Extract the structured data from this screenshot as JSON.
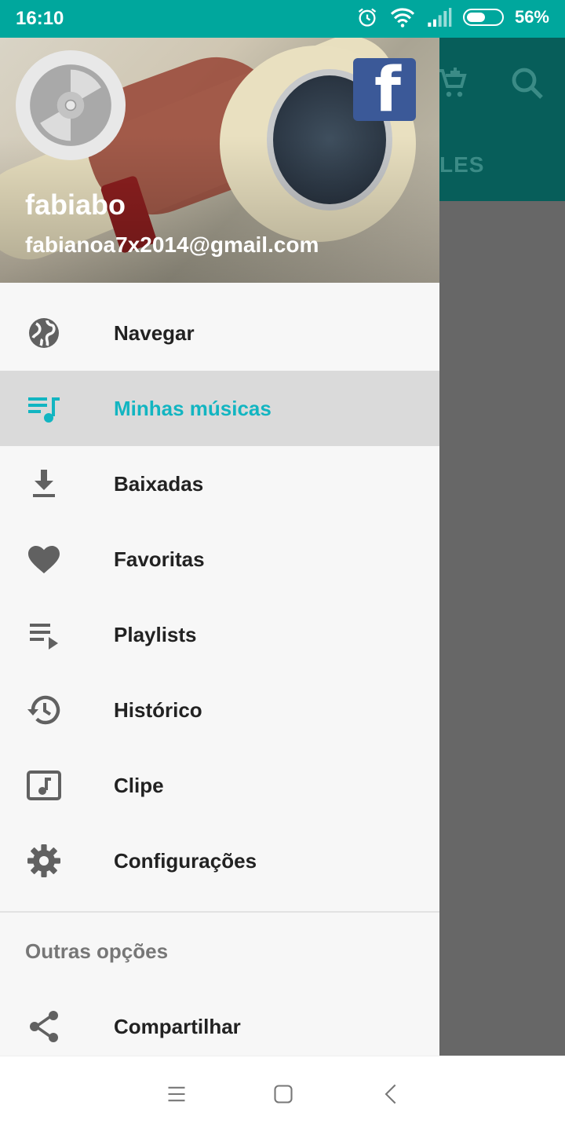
{
  "status_bar": {
    "time": "16:10",
    "battery_percent_label": "56%",
    "battery_level": 0.56,
    "icons": [
      "alarm-icon",
      "wifi-icon",
      "signal-icon",
      "battery-icon"
    ],
    "background_color": "#00a79d"
  },
  "background_app": {
    "toolbar_icons": [
      "add-to-cart-icon",
      "search-icon"
    ],
    "tab_partial_label": "LES"
  },
  "drawer": {
    "header": {
      "user_name": "fabiabo",
      "user_email": "fabianoa7x2014@gmail.com",
      "facebook_glyph": "f"
    },
    "menu_items": [
      {
        "label": "Navegar",
        "icon": "globe-icon",
        "active": false
      },
      {
        "label": "Minhas músicas",
        "icon": "music-queue-icon",
        "active": true
      },
      {
        "label": "Baixadas",
        "icon": "download-icon",
        "active": false
      },
      {
        "label": "Favoritas",
        "icon": "heart-icon",
        "active": false
      },
      {
        "label": "Playlists",
        "icon": "playlist-play-icon",
        "active": false
      },
      {
        "label": "Histórico",
        "icon": "history-icon",
        "active": false
      },
      {
        "label": "Clipe",
        "icon": "music-video-icon",
        "active": false
      },
      {
        "label": "Configurações",
        "icon": "gear-icon",
        "active": false
      }
    ],
    "section_title": "Outras opções",
    "other_items": [
      {
        "label": "Compartilhar",
        "icon": "share-icon"
      }
    ]
  },
  "nav_bar": {
    "buttons": [
      "menu-icon",
      "home-square-icon",
      "back-chevron-icon"
    ]
  },
  "colors": {
    "accent": "#12b5c1",
    "active_row": "#dadada",
    "drawer_bg": "#f7f7f7",
    "scrim": "#676767",
    "toolbar_dark": "#075e5a",
    "facebook": "#3b5998"
  }
}
